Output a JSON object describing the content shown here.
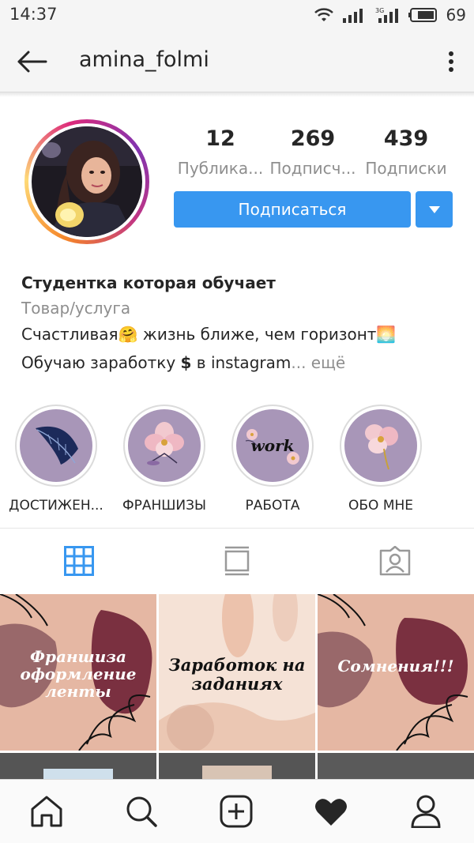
{
  "status": {
    "time": "14:37",
    "battery": "69"
  },
  "header": {
    "username": "amina_folmi"
  },
  "stats": [
    {
      "value": "12",
      "label": "Публика..."
    },
    {
      "value": "269",
      "label": "Подписч..."
    },
    {
      "value": "439",
      "label": "Подписки"
    }
  ],
  "actions": {
    "follow_label": "Подписаться"
  },
  "bio": {
    "name": "Студентка которая обучает",
    "category": "Товар/услуга",
    "line1": "Счастливая🤗 жизнь ближе, чем горизонт🌅",
    "line2_prefix": "Обучаю заработку ",
    "line2_dollar": "$",
    "line2_suffix": " в instagram",
    "more": "... ещё"
  },
  "highlights": [
    {
      "label": "ДОСТИЖЕН...",
      "icon": "leaf-icon"
    },
    {
      "label": "ФРАНШИЗЫ",
      "icon": "flower-icon"
    },
    {
      "label": "РАБОТА",
      "icon": "work-icon",
      "text": "work"
    },
    {
      "label": "ОБО МНЕ",
      "icon": "flower-icon"
    }
  ],
  "tabs": [
    {
      "name": "grid",
      "icon": "grid-icon",
      "active": true
    },
    {
      "name": "feed",
      "icon": "feed-icon",
      "active": false
    },
    {
      "name": "tagged",
      "icon": "tagged-icon",
      "active": false
    }
  ],
  "posts": [
    {
      "caption": "Франшиза оформление ленты"
    },
    {
      "caption": "Заработок на заданиях"
    },
    {
      "caption": "Сомнения!!!"
    }
  ],
  "colors": {
    "accent": "#3897f0",
    "highlight_bg": "#a896b8",
    "post_peach": "#e5b7a3",
    "post_maroon": "#7a3040"
  }
}
